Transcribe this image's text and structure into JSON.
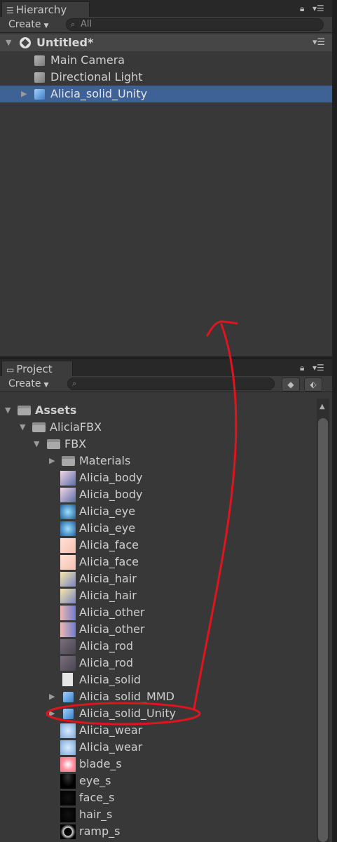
{
  "hierarchy": {
    "tab_label": "Hierarchy",
    "create_label": "Create",
    "search_placeholder": "All",
    "scene_name": "Untitled*",
    "items": [
      {
        "label": "Main Camera"
      },
      {
        "label": "Directional Light"
      },
      {
        "label": "Alicia_solid_Unity",
        "selected": true
      }
    ]
  },
  "project": {
    "tab_label": "Project",
    "create_label": "Create",
    "root": "Assets",
    "folders": [
      "AliciaFBX",
      "FBX",
      "Materials"
    ],
    "items": [
      {
        "label": "Alicia_body",
        "icon": "texture-thumb"
      },
      {
        "label": "Alicia_body",
        "icon": "texture-thumb"
      },
      {
        "label": "Alicia_eye",
        "icon": "texture-thumb"
      },
      {
        "label": "Alicia_eye",
        "icon": "texture-thumb"
      },
      {
        "label": "Alicia_face",
        "icon": "texture-thumb"
      },
      {
        "label": "Alicia_face",
        "icon": "texture-thumb"
      },
      {
        "label": "Alicia_hair",
        "icon": "texture-thumb"
      },
      {
        "label": "Alicia_hair",
        "icon": "texture-thumb"
      },
      {
        "label": "Alicia_other",
        "icon": "texture-thumb"
      },
      {
        "label": "Alicia_other",
        "icon": "texture-thumb"
      },
      {
        "label": "Alicia_rod",
        "icon": "texture-thumb"
      },
      {
        "label": "Alicia_rod",
        "icon": "texture-thumb"
      },
      {
        "label": "Alicia_solid",
        "icon": "document-icon"
      },
      {
        "label": "Alicia_solid_MMD",
        "icon": "model-prefab-icon"
      },
      {
        "label": "Alicia_solid_Unity",
        "icon": "model-prefab-icon"
      },
      {
        "label": "Alicia_wear",
        "icon": "texture-thumb"
      },
      {
        "label": "Alicia_wear",
        "icon": "texture-thumb"
      },
      {
        "label": "blade_s",
        "icon": "texture-thumb"
      },
      {
        "label": "eye_s",
        "icon": "texture-thumb"
      },
      {
        "label": "face_s",
        "icon": "texture-thumb"
      },
      {
        "label": "hair_s",
        "icon": "texture-thumb"
      },
      {
        "label": "ramp_s",
        "icon": "texture-thumb"
      }
    ]
  },
  "annotation_color": "#e0141e",
  "selection_color": "#3e6296"
}
